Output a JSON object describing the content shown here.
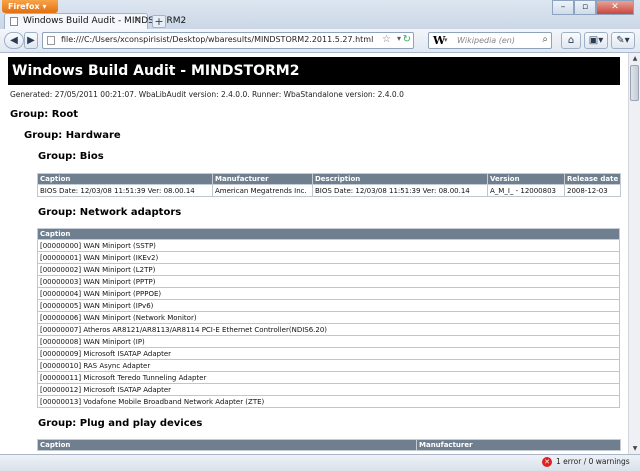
{
  "browser": {
    "menu_label": "Firefox",
    "tab_title": "Windows Build Audit - MINDSTORM2",
    "new_tab": "+",
    "url": "file:///C:/Users/xconspirisist/Desktop/wbaresults/MINDSTORM2.2011.5.27.html",
    "search_engine_letter": "W",
    "search_placeholder": "Wikipedia (en)",
    "status_error": "1 error / 0 warnings"
  },
  "page": {
    "title": "Windows Build Audit - MINDSTORM2",
    "generated": "Generated: 27/05/2011 00:21:07. WbaLibAudit version: 2.4.0.0. Runner: WbaStandalone version: 2.4.0.0",
    "group_root": "Group: Root",
    "group_hardware": "Group: Hardware",
    "group_bios": "Group: Bios",
    "group_network": "Group: Network adaptors",
    "group_pnp": "Group: Plug and play devices"
  },
  "bios_table": {
    "headers": [
      "Caption",
      "Manufacturer",
      "Description",
      "Version",
      "Release date"
    ],
    "row": [
      "BIOS Date: 12/03/08 11:51:39 Ver: 08.00.14",
      "American Megatrends Inc.",
      "BIOS Date: 12/03/08 11:51:39 Ver: 08.00.14",
      "A_M_I_ - 12000803",
      "2008-12-03"
    ]
  },
  "network_table": {
    "header": "Caption",
    "rows": [
      "[00000000] WAN Miniport (SSTP)",
      "[00000001] WAN Miniport (IKEv2)",
      "[00000002] WAN Miniport (L2TP)",
      "[00000003] WAN Miniport (PPTP)",
      "[00000004] WAN Miniport (PPPOE)",
      "[00000005] WAN Miniport (IPv6)",
      "[00000006] WAN Miniport (Network Monitor)",
      "[00000007] Atheros AR8121/AR8113/AR8114 PCI-E Ethernet Controller(NDIS6.20)",
      "[00000008] WAN Miniport (IP)",
      "[00000009] Microsoft ISATAP Adapter",
      "[00000010] RAS Async Adapter",
      "[00000011] Microsoft Teredo Tunneling Adapter",
      "[00000012] Microsoft ISATAP Adapter",
      "[00000013] Vodafone Mobile Broadband Network Adapter (ZTE)"
    ]
  },
  "pnp_table": {
    "headers": [
      "Caption",
      "Manufacturer"
    ]
  }
}
